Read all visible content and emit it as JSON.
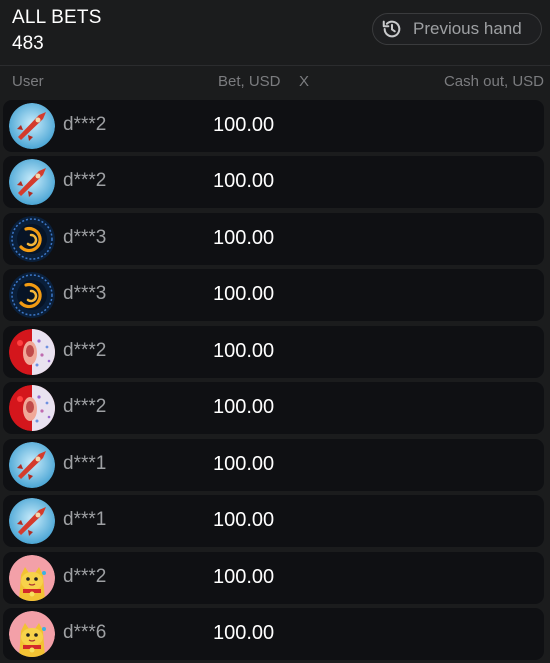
{
  "header": {
    "title": "ALL BETS",
    "count": "483",
    "previous_hand_label": "Previous hand"
  },
  "columns": {
    "user": "User",
    "bet": "Bet, USD",
    "x": "X",
    "cashout": "Cash out, USD"
  },
  "rows": [
    {
      "user": "d***2",
      "bet": "100.00",
      "avatar": "rocket-avatar"
    },
    {
      "user": "d***2",
      "bet": "100.00",
      "avatar": "rocket-avatar"
    },
    {
      "user": "d***3",
      "bet": "100.00",
      "avatar": "orbit-avatar"
    },
    {
      "user": "d***3",
      "bet": "100.00",
      "avatar": "orbit-avatar"
    },
    {
      "user": "d***2",
      "bet": "100.00",
      "avatar": "red-character-avatar"
    },
    {
      "user": "d***2",
      "bet": "100.00",
      "avatar": "red-character-avatar"
    },
    {
      "user": "d***1",
      "bet": "100.00",
      "avatar": "rocket-avatar"
    },
    {
      "user": "d***1",
      "bet": "100.00",
      "avatar": "rocket-avatar"
    },
    {
      "user": "d***2",
      "bet": "100.00",
      "avatar": "lucky-cat-avatar"
    },
    {
      "user": "d***6",
      "bet": "100.00",
      "avatar": "lucky-cat-avatar"
    }
  ],
  "colors": {
    "background": "#1b1c1d",
    "row_background": "#0f1013",
    "muted_text": "#9ea0a3",
    "header_text": "#7b7c7f"
  }
}
